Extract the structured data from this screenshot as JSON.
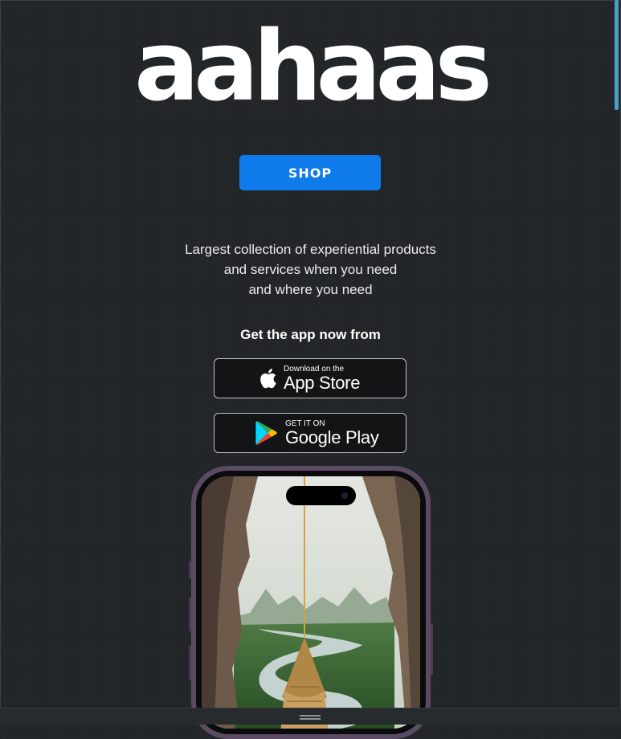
{
  "brand": {
    "logo_text": "aahaas"
  },
  "shop_button": {
    "label": "SHOP"
  },
  "tagline": {
    "lines": [
      "Largest collection of experiential products",
      "and services when you need",
      "and where you need"
    ]
  },
  "get_app": {
    "heading": "Get the app now from"
  },
  "app_store": {
    "small": "Download on the",
    "big": "App Store",
    "icon": "apple-icon"
  },
  "google_play": {
    "small": "GET IT ON",
    "big": "Google Play",
    "icon": "google-play-icon"
  },
  "colors": {
    "background": "#232628",
    "accent": "#0f7bea",
    "scroll_thumb": "#4b9fc9"
  }
}
